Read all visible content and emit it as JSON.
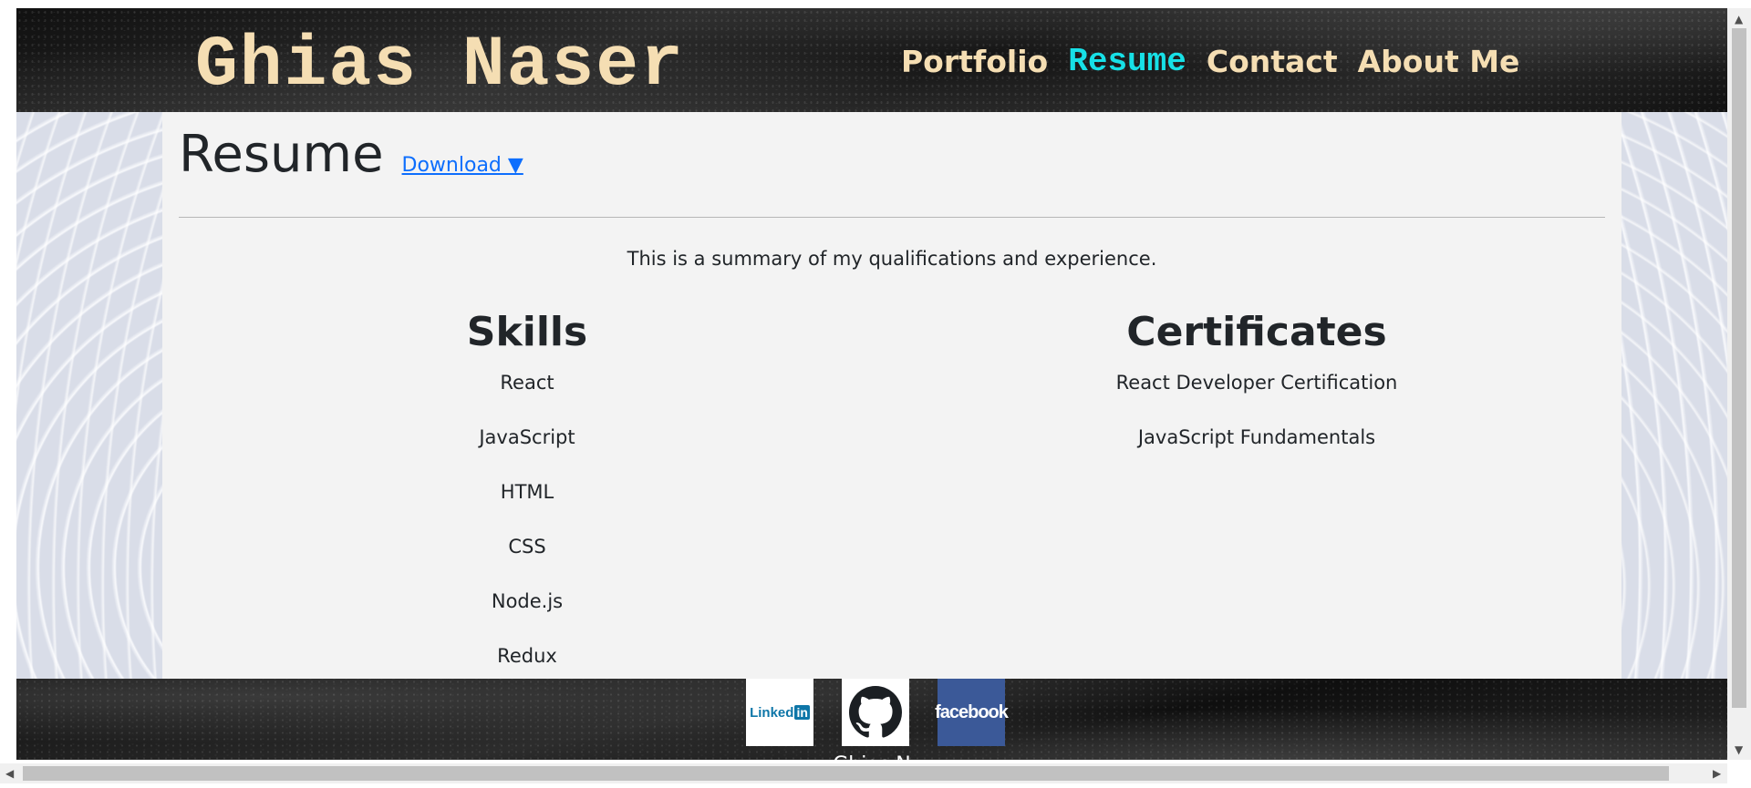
{
  "header": {
    "site_title": "Ghias Naser",
    "nav": [
      {
        "label": "Portfolio",
        "active": false
      },
      {
        "label": "Resume",
        "active": true
      },
      {
        "label": "Contact",
        "active": false
      },
      {
        "label": "About Me",
        "active": false
      }
    ]
  },
  "resume": {
    "title": "Resume",
    "download_label": "Download ▼",
    "summary": "This is a summary of my qualifications and experience.",
    "skills": {
      "heading": "Skills",
      "items": [
        "React",
        "JavaScript",
        "HTML",
        "CSS",
        "Node.js",
        "Redux"
      ]
    },
    "certificates": {
      "heading": "Certificates",
      "items": [
        "React Developer Certification",
        "JavaScript Fundamentals"
      ]
    }
  },
  "footer": {
    "social": [
      {
        "name": "linkedin",
        "label": "Linked",
        "label_badge": "in"
      },
      {
        "name": "github",
        "label": ""
      },
      {
        "name": "facebook",
        "label": "facebook"
      }
    ],
    "name": "Ghias N"
  },
  "colors": {
    "title": "#f5deb3",
    "nav_active": "#17e0e6",
    "link": "#0d6efd",
    "card_bg": "#f3f3f3",
    "facebook": "#3b5998",
    "linkedin": "#0e76a8"
  }
}
